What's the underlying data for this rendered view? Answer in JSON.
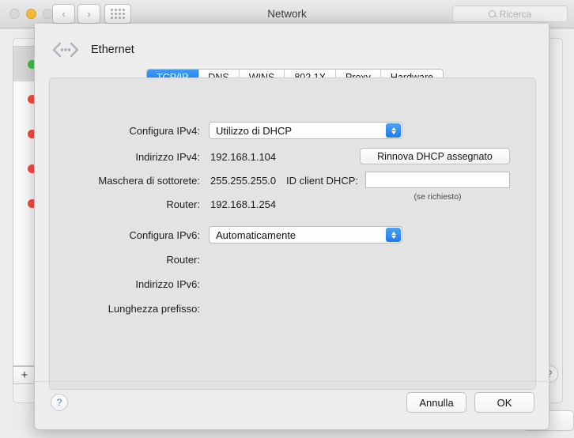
{
  "window": {
    "title": "Network",
    "traffic_lights": [
      {
        "name": "close",
        "state": "inactive"
      },
      {
        "name": "minimize",
        "state": "amber"
      },
      {
        "name": "zoom",
        "state": "inactive"
      }
    ],
    "nav_back": "‹",
    "nav_forward": "›",
    "show_all_icon": "grid-icon",
    "search": {
      "placeholder": "Ricerca",
      "value": "",
      "icon": "search-icon"
    }
  },
  "sidebar": {
    "add_button": "+",
    "services": [
      {
        "status": "green",
        "selected": true
      },
      {
        "status": "red",
        "selected": false
      },
      {
        "status": "red",
        "selected": false
      },
      {
        "status": "red",
        "selected": false
      },
      {
        "status": "red",
        "selected": false
      }
    ]
  },
  "background_pane": {
    "help_label": "?"
  },
  "sheet": {
    "icon": "ethernet-icon",
    "title": "Ethernet",
    "tabs": [
      {
        "label": "TCP/IP",
        "active": true
      },
      {
        "label": "DNS",
        "active": false
      },
      {
        "label": "WINS",
        "active": false
      },
      {
        "label": "802.1X",
        "active": false
      },
      {
        "label": "Proxy",
        "active": false
      },
      {
        "label": "Hardware",
        "active": false
      }
    ],
    "ipv4": {
      "configure_label": "Configura IPv4:",
      "configure_value": "Utilizzo di DHCP",
      "address_label": "Indirizzo IPv4:",
      "address_value": "192.168.1.104",
      "subnet_label": "Maschera di sottorete:",
      "subnet_value": "255.255.255.0",
      "router_label": "Router:",
      "router_value": "192.168.1.254",
      "renew_button": "Rinnova DHCP assegnato",
      "dhcp_client_label": "ID client DHCP:",
      "dhcp_client_value": "",
      "dhcp_client_hint": "(se richiesto)"
    },
    "ipv6": {
      "configure_label": "Configura IPv6:",
      "configure_value": "Automaticamente",
      "router_label": "Router:",
      "router_value": "",
      "address_label": "Indirizzo IPv6:",
      "address_value": "",
      "prefix_label": "Lunghezza prefisso:",
      "prefix_value": ""
    },
    "help_label": "?",
    "cancel_button": "Annulla",
    "ok_button": "OK"
  },
  "colors": {
    "accent_blue": "#1277ec",
    "status_green": "#3fc44b",
    "status_red": "#fa4b41",
    "window_bg": "#ececec",
    "sheet_bg": "#ededed",
    "content_bg": "#e3e3e3"
  }
}
